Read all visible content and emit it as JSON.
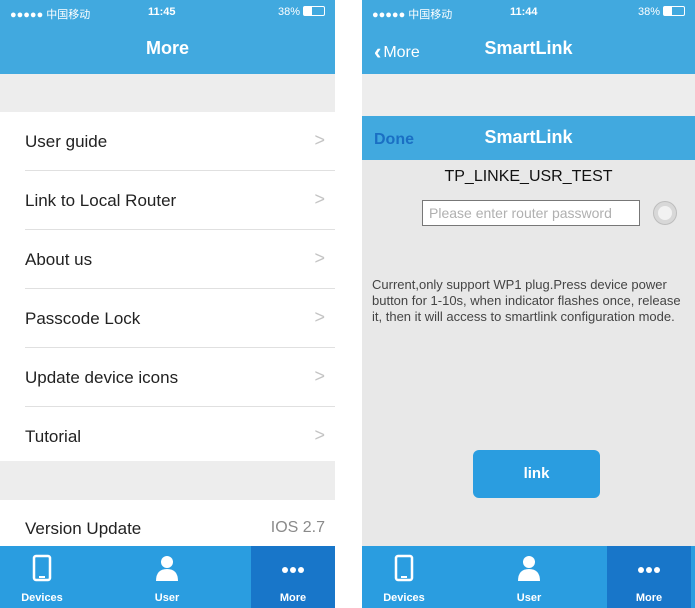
{
  "left": {
    "status": {
      "carrier": "●●●●● 中国移动",
      "time": "11:45",
      "battery": "38%"
    },
    "nav": {
      "title": "More"
    },
    "menu": [
      {
        "label": "User guide",
        "chevron": ">"
      },
      {
        "label": "Link to Local Router",
        "chevron": ">"
      },
      {
        "label": "About us",
        "chevron": ">"
      },
      {
        "label": "Passcode Lock",
        "chevron": ">"
      },
      {
        "label": "Update device icons",
        "chevron": ">"
      },
      {
        "label": "Tutorial",
        "chevron": ">"
      }
    ],
    "version": {
      "label": "Version Update",
      "value": "IOS 2.7"
    },
    "tabs": [
      {
        "label": "Devices",
        "icon": "phone-icon"
      },
      {
        "label": "User",
        "icon": "user-icon"
      },
      {
        "label": "More",
        "icon": "more-dots-icon"
      }
    ],
    "active_tab": "More"
  },
  "right": {
    "status": {
      "carrier": "●●●●● 中国移动",
      "time": "11:44",
      "battery": "38%"
    },
    "nav": {
      "back": "More",
      "title": "SmartLink"
    },
    "dialog": {
      "done": "Done",
      "title": "SmartLink",
      "ssid": "TP_LINKE_USR_TEST",
      "password_placeholder": "Please enter router password",
      "info": "Current,only support WP1 plug.Press device power button for 1-10s, when indicator flashes once, release it, then it will access to smartlink configuration mode.",
      "link_button": "link"
    },
    "tabs": [
      {
        "label": "Devices",
        "icon": "phone-icon"
      },
      {
        "label": "User",
        "icon": "user-icon"
      },
      {
        "label": "More",
        "icon": "more-dots-icon"
      }
    ],
    "active_tab": "More"
  },
  "colors": {
    "accent": "#41a9df",
    "tab_bar": "#2a9de0",
    "tab_active": "#1876c9",
    "done": "#1a6fc4"
  }
}
